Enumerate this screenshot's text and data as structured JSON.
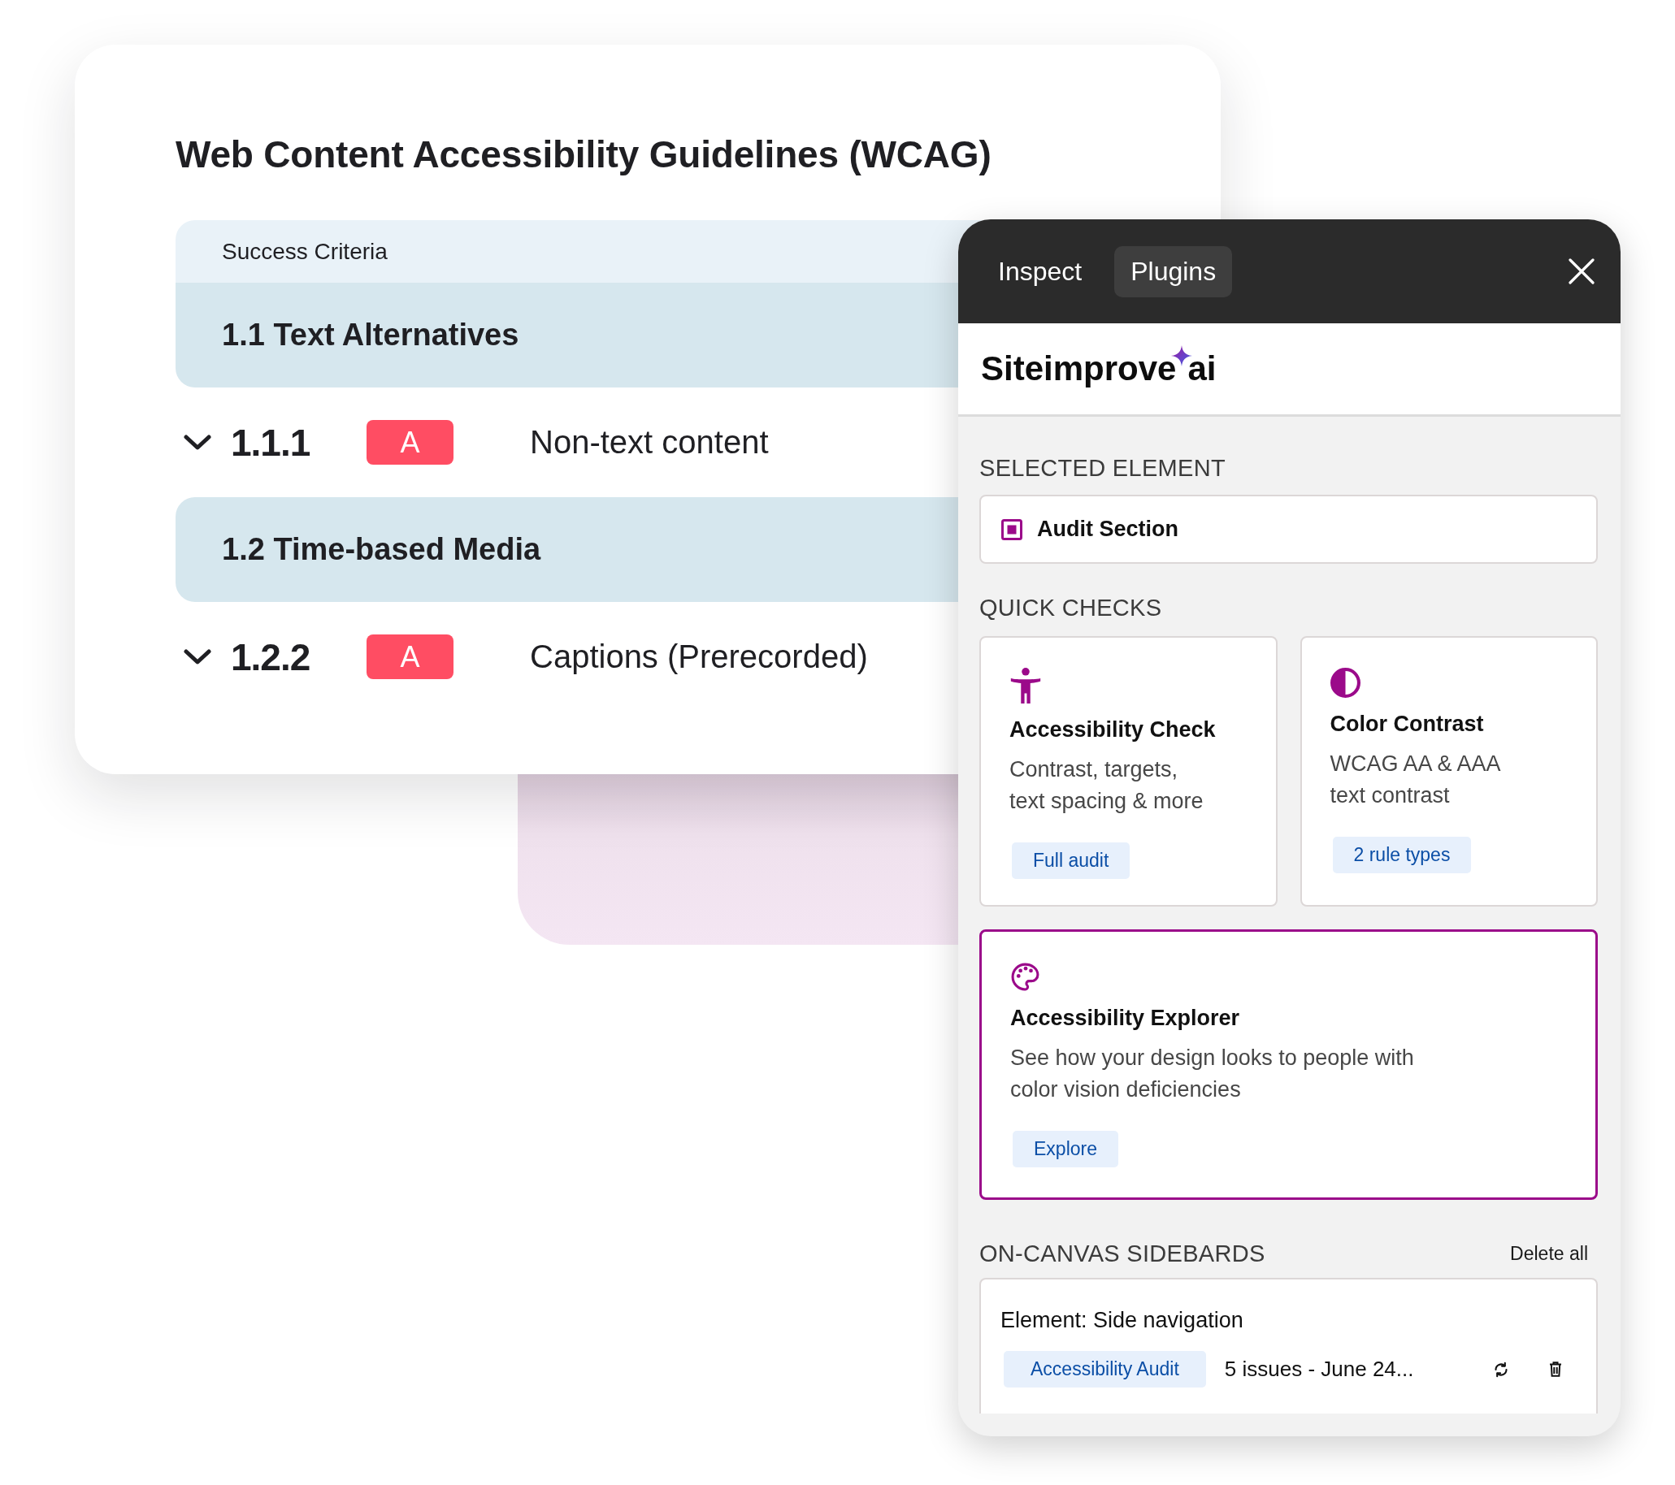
{
  "guidelines": {
    "title": "Web Content Accessibility Guidelines (WCAG)",
    "table": {
      "header": "Success Criteria",
      "sections": [
        {
          "title": "1.1 Text Alternatives",
          "criteria": [
            {
              "number": "1.1.1",
              "level": "A",
              "name": "Non-text content"
            }
          ]
        },
        {
          "title": "1.2 Time-based Media",
          "criteria": [
            {
              "number": "1.2.2",
              "level": "A",
              "name": "Captions (Prerecorded)"
            }
          ]
        }
      ]
    }
  },
  "plugin_panel": {
    "tabs": [
      {
        "label": "Inspect",
        "selected": false
      },
      {
        "label": "Plugins",
        "selected": true
      }
    ],
    "logo": {
      "name": "Siteimprove",
      "suffix": "ai"
    },
    "selected_element": {
      "heading": "SELECTED ELEMENT",
      "label": "Audit Section"
    },
    "quick_checks": {
      "heading": "QUICK CHECKS",
      "cards": [
        {
          "title": "Accessibility Check",
          "description": "Contrast, targets, text spacing & more",
          "action": "Full audit",
          "selected": false
        },
        {
          "title": "Color Contrast",
          "description": "WCAG AA & AAA text contrast",
          "action": "2 rule types",
          "selected": false
        },
        {
          "title": "Accessibility Explorer",
          "description": "See how your design looks to people with color vision deficiencies",
          "action": "Explore",
          "selected": true
        }
      ]
    },
    "sidebards": {
      "heading": "ON-CANVAS SIDEBARDS",
      "delete_all": "Delete all",
      "items": [
        {
          "element": "Element: Side navigation",
          "tag": "Accessibility Audit",
          "summary": "5 issues - June 24..."
        }
      ]
    }
  }
}
